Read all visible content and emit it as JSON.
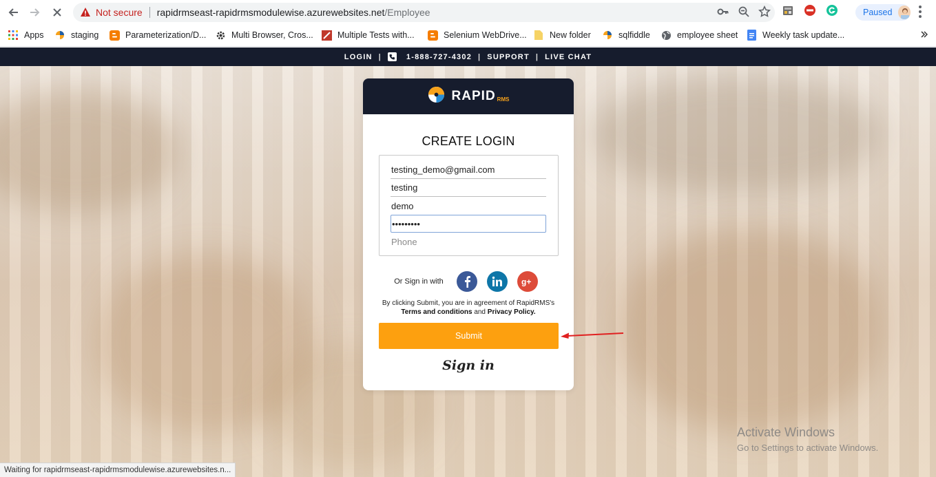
{
  "browser": {
    "security_label": "Not secure",
    "url_host": "rapidrmseast-rapidrmsmodulewise.azurewebsites.net",
    "url_path": "/Employee",
    "profile_label": "Paused",
    "status_text": "Waiting for rapidrmseast-rapidrmsmodulewise.azurewebsites.n..."
  },
  "bookmarks": [
    {
      "label": "Apps",
      "icon": "apps-grid-icon"
    },
    {
      "label": "staging",
      "icon": "site-icon"
    },
    {
      "label": "Parameterization/D...",
      "icon": "blogger-icon"
    },
    {
      "label": "Multi Browser, Cros...",
      "icon": "gear-icon"
    },
    {
      "label": "Multiple Tests with...",
      "icon": "site-icon"
    },
    {
      "label": "Selenium WebDrive...",
      "icon": "blogger-icon"
    },
    {
      "label": "New folder",
      "icon": "folder-icon"
    },
    {
      "label": "sqlfiddle",
      "icon": "site-icon"
    },
    {
      "label": "employee sheet",
      "icon": "globe-icon"
    },
    {
      "label": "Weekly task update...",
      "icon": "doc-icon"
    }
  ],
  "topbar": {
    "login": "LOGIN",
    "phone": "1-888-727-4302",
    "support": "SUPPORT",
    "live_chat": "LIVE CHAT"
  },
  "brand": {
    "name": "RAPID",
    "suffix": "RMS"
  },
  "form": {
    "title": "CREATE LOGIN",
    "email": "testing_demo@gmail.com",
    "first_name": "testing",
    "last_name": "demo",
    "password": "•••••••••",
    "phone_placeholder": "Phone",
    "social_label": "Or Sign in with",
    "agree_line1": "By clicking Submit, you are in agreement of RapidRMS's",
    "terms": "Terms and conditions",
    "and": "and",
    "privacy": "Privacy Policy.",
    "submit": "Submit",
    "signin": "Sign in"
  },
  "watermark": {
    "title": "Activate Windows",
    "subtitle": "Go to Settings to activate Windows."
  },
  "colors": {
    "accent": "#fda00f",
    "header": "#161c2d",
    "facebook": "#3b5998",
    "linkedin": "#0e76a8",
    "google_plus": "#dd4b39",
    "arrow": "#e02020"
  }
}
